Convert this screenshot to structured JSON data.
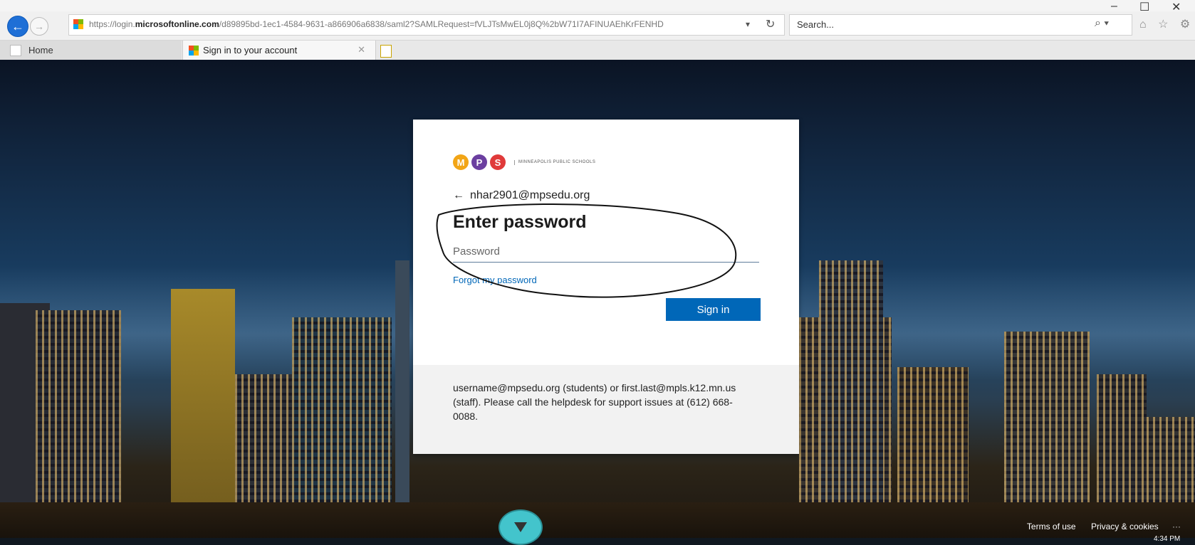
{
  "browser": {
    "url_prefix": "https://login.",
    "url_domain": "microsoftonline.com",
    "url_rest": "/d89895bd-1ec1-4584-9631-a866906a6838/saml2?SAMLRequest=fVLJTsMwEL0j8Q%2bW71I7AFINUAEhKrFENHD",
    "url_dropdown": "▾",
    "refresh_glyph": "↻",
    "search_placeholder": "Search...",
    "search_icon_glyph": "⌕ ▾",
    "tools_glyphs": "⌂ ☆ ⚙",
    "minimize": "–",
    "maximize": "☐",
    "close": "✕",
    "back_glyph": "←",
    "forward_glyph": "→"
  },
  "tabs": {
    "home_label": "Home",
    "active_label": "Sign in to your account",
    "close_glyph": "✕"
  },
  "login": {
    "logo_letters": [
      "M",
      "P",
      "S"
    ],
    "logo_text": "MINNEAPOLIS PUBLIC SCHOOLS",
    "back_arrow": "←",
    "identity": "nhar2901@mpsedu.org",
    "heading": "Enter password",
    "password_placeholder": "Password",
    "forgot_link": "Forgot my password",
    "signin_button": "Sign in",
    "help_text": "username@mpsedu.org (students) or first.last@mpls.k12.mn.us (staff). Please call the helpdesk for support issues at (612) 668-0088."
  },
  "footer": {
    "terms": "Terms of use",
    "privacy": "Privacy & cookies",
    "more": "···"
  },
  "taskbar": {
    "clock": "4:34 PM"
  },
  "colors": {
    "accent": "#0067b8",
    "logo_m": "#f2a516",
    "logo_p": "#6b3fa0",
    "logo_s": "#e03a3a"
  }
}
